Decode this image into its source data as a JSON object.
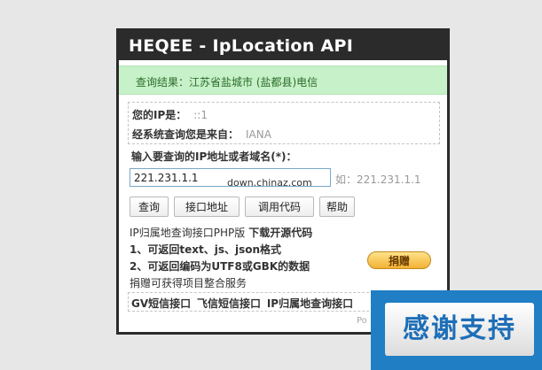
{
  "app": {
    "title": "HEQEE - IpLocation API"
  },
  "result": {
    "text": "查询结果：江苏省盐城市 (盐都县)电信"
  },
  "info": {
    "your_ip_label": "您的IP是：",
    "your_ip_value": "::1",
    "source_label": "经系统查询您是来自：",
    "source_value": "IANA"
  },
  "form": {
    "query_label": "输入要查询的IP地址或者域名(*)：",
    "ip_value": "221.231.1.1",
    "example": "如：221.231.1.1",
    "watermark": "down.chinaz.com",
    "buttons": {
      "query": "查询",
      "api_url": "接口地址",
      "call_code": "调用代码",
      "help": "帮助"
    }
  },
  "description": {
    "line1_text": "IP归属地查询接口PHP版",
    "download_link": "下载开源代码",
    "line2": "1、可返回text、js、json格式",
    "line3": "2、可返回编码为UTF8或GBK的数据",
    "line4": "捐赠可获得项目整合服务",
    "donate_label": "捐赠"
  },
  "links": [
    "GV短信接口",
    "飞信短信接口",
    "IP归属地查询接口"
  ],
  "footer": {
    "powered": "Po"
  },
  "overlay": {
    "text": "感谢支持"
  }
}
